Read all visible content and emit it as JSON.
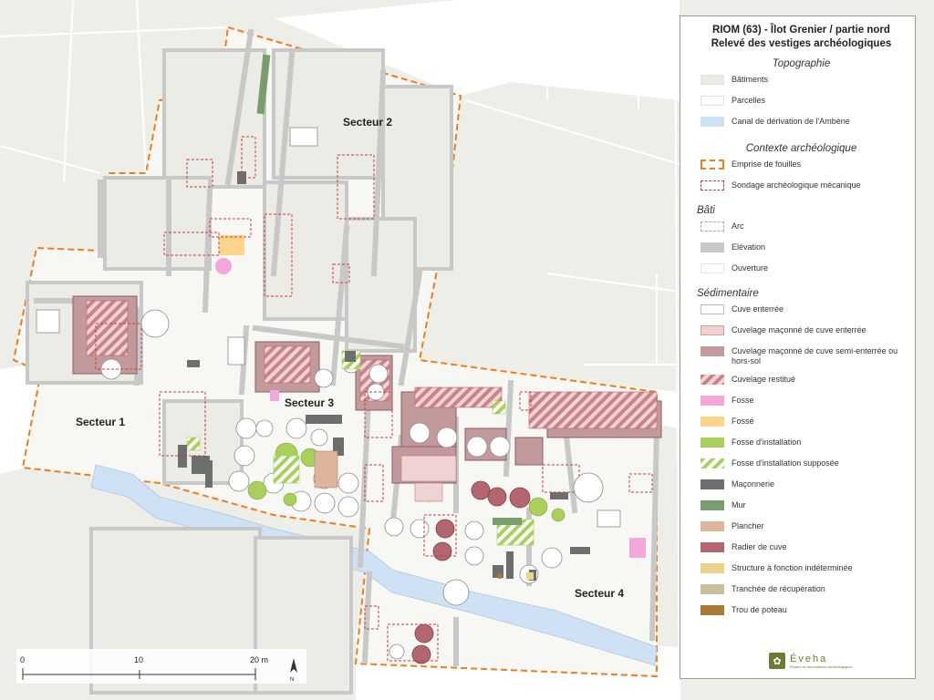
{
  "legend": {
    "title_line1": "RIOM (63) - Îlot Grenier / partie nord",
    "title_line2": "Relevé des vestiges archéologiques",
    "sections": {
      "topographie": "Topographie",
      "contexte": "Contexte archéologique",
      "bati": "Bâti",
      "sedimentaire": "Sédimentaire"
    },
    "items": {
      "batiments": "Bâtiments",
      "parcelles": "Parcelles",
      "canal": "Canal de dérivation de l'Ambène",
      "emprise": "Emprise de fouilles",
      "sondage": "Sondage archéologique mécanique",
      "arc": "Arc",
      "elevation": "Elévation",
      "ouverture": "Ouverture",
      "cuve_enterree": "Cuve enterrée",
      "cuvelage_enterree": "Cuvelage maçonné de cuve enterrée",
      "cuvelage_semi": "Cuvelage maçonné de cuve semi-enterrée ou hors-sol",
      "cuvelage_restitue": "Cuvelage restitué",
      "fosse": "Fosse",
      "fosse2": "Fossé",
      "fosse_installation": "Fosse d'installation",
      "fosse_installation_supposee": "Fosse d'installation supposée",
      "maconnerie": "Maçonnerie",
      "mur": "Mur",
      "plancher": "Plancher",
      "radier": "Radier de cuve",
      "structure": "Structure à fonction indéterminée",
      "tranchee": "Tranchée de récupération",
      "trou": "Trou de poteau"
    },
    "logo_name": "Éveha",
    "logo_sub": "Etudes et valorisations archéologiques"
  },
  "map": {
    "sectors": [
      "Secteur 1",
      "Secteur 2",
      "Secteur 3",
      "Secteur 4"
    ]
  },
  "scale": {
    "ticks": [
      "0",
      "10",
      "20 m"
    ],
    "north": "N"
  },
  "colors": {
    "building": "#ecece6",
    "parcel": "#ffffff",
    "canal": "#cfe1f5",
    "emprise": "#ee7d1e",
    "sondage": "#d03a3a",
    "wall": "#c8c8c8",
    "cuvelage_enterree": "#f0d2d3",
    "cuvelage_semi": "#c39a9c",
    "fosse": "#f4a7d8",
    "fosse2": "#fcd58b",
    "fosse_installation": "#a9cf5d",
    "maconnerie": "#6e6e6e",
    "mur": "#7a9d70",
    "plancher": "#deb59a",
    "radier": "#b36670",
    "structure": "#ecd48a",
    "tranchee": "#c9bf9a",
    "trou": "#a87a33"
  }
}
